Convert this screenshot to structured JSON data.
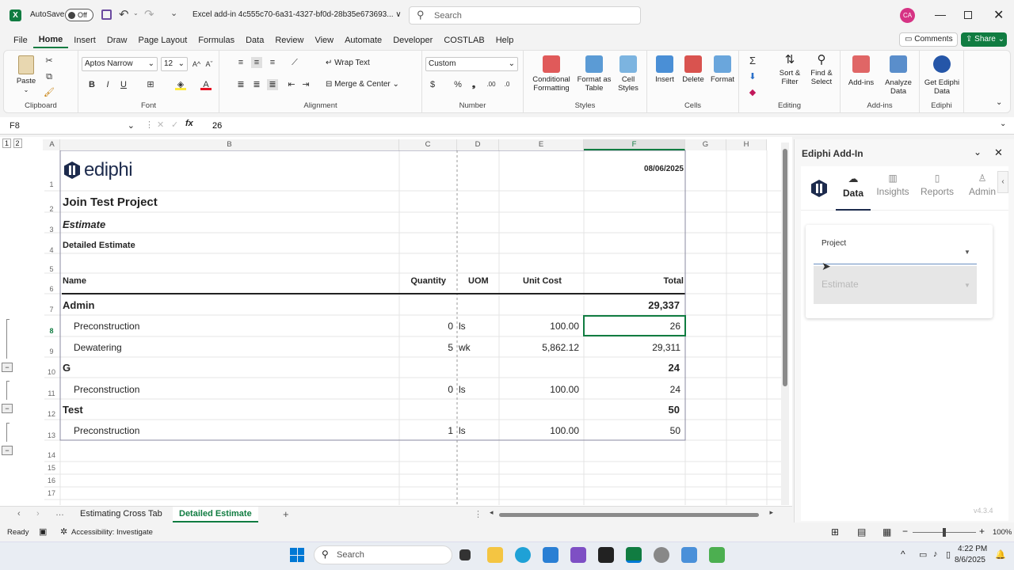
{
  "titlebar": {
    "autosave": "AutoSave",
    "toggle": "Off",
    "filename": "Excel add-in 4c555c70-6a31-4327-bf0d-28b35e673693... ∨",
    "search": "Search",
    "avatar": "CA"
  },
  "tabs": [
    "File",
    "Home",
    "Insert",
    "Draw",
    "Page Layout",
    "Formulas",
    "Data",
    "Review",
    "View",
    "Automate",
    "Developer",
    "COSTLAB",
    "Help"
  ],
  "ribbon_right": {
    "comments": "Comments",
    "share": "Share"
  },
  "ribbon": {
    "paste": "Paste",
    "clipboard": "Clipboard",
    "font_name": "Aptos Narrow",
    "font_size": "12",
    "font": "Font",
    "wrap_text": "Wrap Text",
    "merge_center": "Merge & Center",
    "alignment": "Alignment",
    "number_format": "Custom",
    "number": "Number",
    "conditional": "Conditional Formatting",
    "format_table": "Format as Table",
    "cell_styles": "Cell Styles",
    "styles": "Styles",
    "insert": "Insert",
    "delete": "Delete",
    "format": "Format",
    "cells": "Cells",
    "sort_filter": "Sort & Filter",
    "find_select": "Find & Select",
    "editing": "Editing",
    "addins": "Add-ins",
    "addins_grp": "Add-ins",
    "analyze": "Analyze Data",
    "get_ediphi": "Get Ediphi Data",
    "ediphi_grp": "Ediphi"
  },
  "formula_bar": {
    "namebox": "F8",
    "value": "26"
  },
  "columns": [
    "A",
    "B",
    "C",
    "D",
    "E",
    "F",
    "G",
    "H"
  ],
  "rows": [
    "1",
    "2",
    "3",
    "4",
    "5",
    "6",
    "7",
    "8",
    "9",
    "10",
    "11",
    "12",
    "13",
    "14",
    "15",
    "16",
    "17"
  ],
  "sheet": {
    "logo": "ediphi",
    "date": "08/06/2025",
    "project": "Join Test Project",
    "estimate": "Estimate",
    "detailed": "Detailed Estimate",
    "headers": {
      "name": "Name",
      "quantity": "Quantity",
      "uom": "UOM",
      "unit_cost": "Unit Cost",
      "total": "Total"
    },
    "sec1": {
      "name": "Admin",
      "total": "29,337"
    },
    "r8": {
      "name": "Preconstruction",
      "qty": "0",
      "uom": "ls",
      "cost": "100.00",
      "total": "26"
    },
    "r9": {
      "name": "Dewatering",
      "qty": "5",
      "uom": "wk",
      "cost": "5,862.12",
      "total": "29,311"
    },
    "sec2": {
      "name": "G",
      "total": "24"
    },
    "r11": {
      "name": "Preconstruction",
      "qty": "0",
      "uom": "ls",
      "cost": "100.00",
      "total": "24"
    },
    "sec3": {
      "name": "Test",
      "total": "50"
    },
    "r13": {
      "name": "Preconstruction",
      "qty": "1",
      "uom": "ls",
      "cost": "100.00",
      "total": "50"
    }
  },
  "sheet_tabs": [
    "Estimating Cross Tab",
    "Detailed Estimate"
  ],
  "pane": {
    "title": "Ediphi Add-In",
    "tabs": [
      "Data",
      "Insights",
      "Reports",
      "Admin"
    ],
    "project_label": "Project",
    "estimate_placeholder": "Estimate",
    "version": "v4.3.4"
  },
  "status": {
    "ready": "Ready",
    "accessibility": "Accessibility: Investigate",
    "zoom": "100%"
  },
  "taskbar": {
    "search": "Search",
    "time": "4:22 PM",
    "date": "8/6/2025"
  }
}
